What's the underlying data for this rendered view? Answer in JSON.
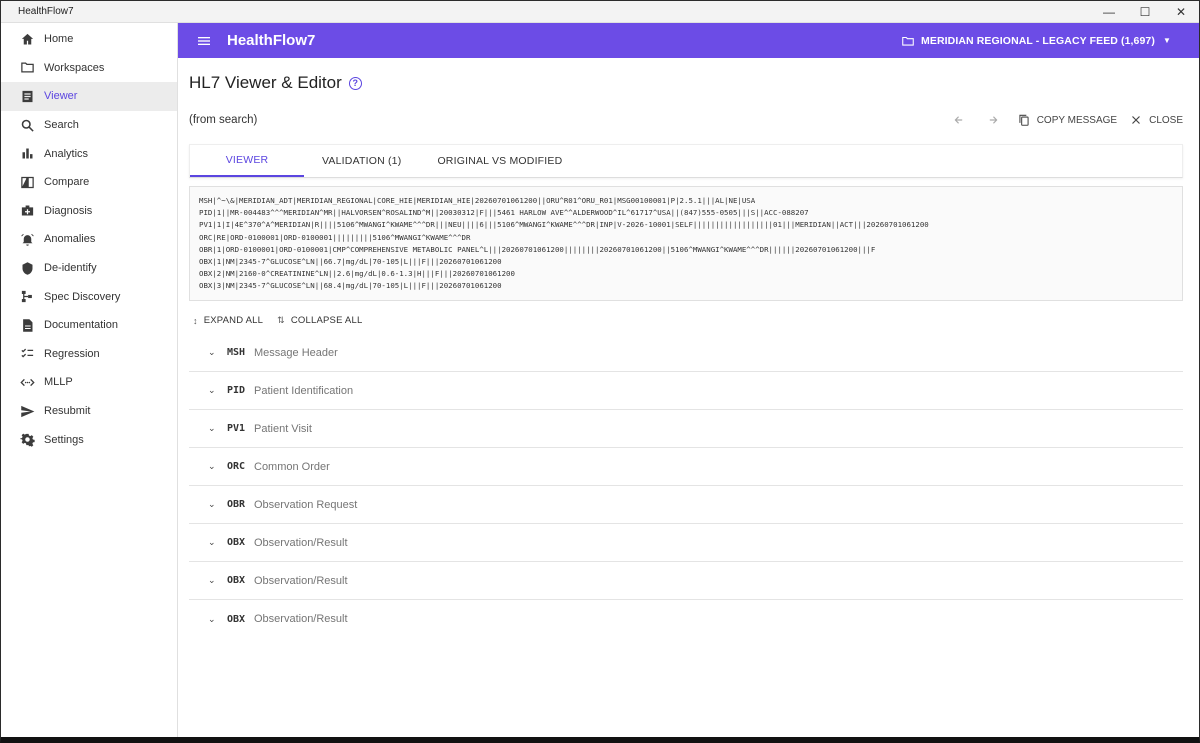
{
  "window": {
    "title": "HealthFlow7",
    "controls": [
      "minimize-icon",
      "maximize-icon",
      "close-icon"
    ]
  },
  "sidebar": {
    "items": [
      {
        "label": "Home",
        "icon": "home-icon"
      },
      {
        "label": "Workspaces",
        "icon": "folder-icon"
      },
      {
        "label": "Viewer",
        "icon": "document-icon",
        "active": true
      },
      {
        "label": "Search",
        "icon": "search-icon"
      },
      {
        "label": "Analytics",
        "icon": "bar-chart-icon"
      },
      {
        "label": "Compare",
        "icon": "compare-icon"
      },
      {
        "label": "Diagnosis",
        "icon": "medical-bag-icon"
      },
      {
        "label": "Anomalies",
        "icon": "alarm-icon"
      },
      {
        "label": "De-identify",
        "icon": "shield-icon"
      },
      {
        "label": "Spec Discovery",
        "icon": "schema-icon"
      },
      {
        "label": "Documentation",
        "icon": "description-icon"
      },
      {
        "label": "Regression",
        "icon": "checklist-icon"
      },
      {
        "label": "MLLP",
        "icon": "code-arrows-icon"
      },
      {
        "label": "Resubmit",
        "icon": "send-icon"
      },
      {
        "label": "Settings",
        "icon": "gear-icon"
      }
    ]
  },
  "appbar": {
    "brand": "HealthFlow7",
    "feed_label": "MERIDIAN REGIONAL - LEGACY FEED (1,697)",
    "accent": "#6c4ce6"
  },
  "page": {
    "title": "HL7 Viewer & Editor",
    "source": "(from search)",
    "actions": {
      "copy": "COPY MESSAGE",
      "close": "CLOSE"
    },
    "tabs": [
      "VIEWER",
      "VALIDATION (1)",
      "ORIGINAL VS MODIFIED"
    ],
    "active_tab": "VIEWER",
    "raw_message": [
      "MSH|^~\\&|MERIDIAN_ADT|MERIDIAN_REGIONAL|CORE_HIE|MERIDIAN_HIE|20260701061200||ORU^R01^ORU_R01|MSG00100001|P|2.5.1|||AL|NE|USA",
      "PID|1||MR-004483^^^MERIDIAN^MR||HALVORSEN^ROSALIND^M||20030312|F|||5461 HARLOW AVE^^ALDERWOOD^IL^61717^USA||(847)555-0505|||S||ACC-088207",
      "PV1|1|I|4E^370^A^MERIDIAN|R||||5106^MWANGI^KWAME^^^DR|||NEU||||6|||5106^MWANGI^KWAME^^^DR|INP|V-2026-10001|SELF||||||||||||||||||01|||MERIDIAN||ACT|||20260701061200",
      "ORC|RE|ORD-0100001|ORD-0100001|||||||||5106^MWANGI^KWAME^^^DR",
      "OBR|1|ORD-0100001|ORD-0100001|CMP^COMPREHENSIVE METABOLIC PANEL^L|||20260701061200||||||||20260701061200||5106^MWANGI^KWAME^^^DR||||||20260701061200|||F",
      "OBX|1|NM|2345-7^GLUCOSE^LN||66.7|mg/dL|70-105|L|||F|||20260701061200",
      "OBX|2|NM|2160-0^CREATININE^LN||2.6|mg/dL|0.6-1.3|H|||F|||20260701061200",
      "OBX|3|NM|2345-7^GLUCOSE^LN||68.4|mg/dL|70-105|L|||F|||20260701061200"
    ],
    "expand_all": "EXPAND ALL",
    "collapse_all": "COLLAPSE ALL",
    "segments": [
      {
        "code": "MSH",
        "desc": "Message Header"
      },
      {
        "code": "PID",
        "desc": "Patient Identification"
      },
      {
        "code": "PV1",
        "desc": "Patient Visit"
      },
      {
        "code": "ORC",
        "desc": "Common Order"
      },
      {
        "code": "OBR",
        "desc": "Observation Request"
      },
      {
        "code": "OBX",
        "desc": "Observation/Result"
      },
      {
        "code": "OBX",
        "desc": "Observation/Result"
      },
      {
        "code": "OBX",
        "desc": "Observation/Result"
      }
    ]
  }
}
